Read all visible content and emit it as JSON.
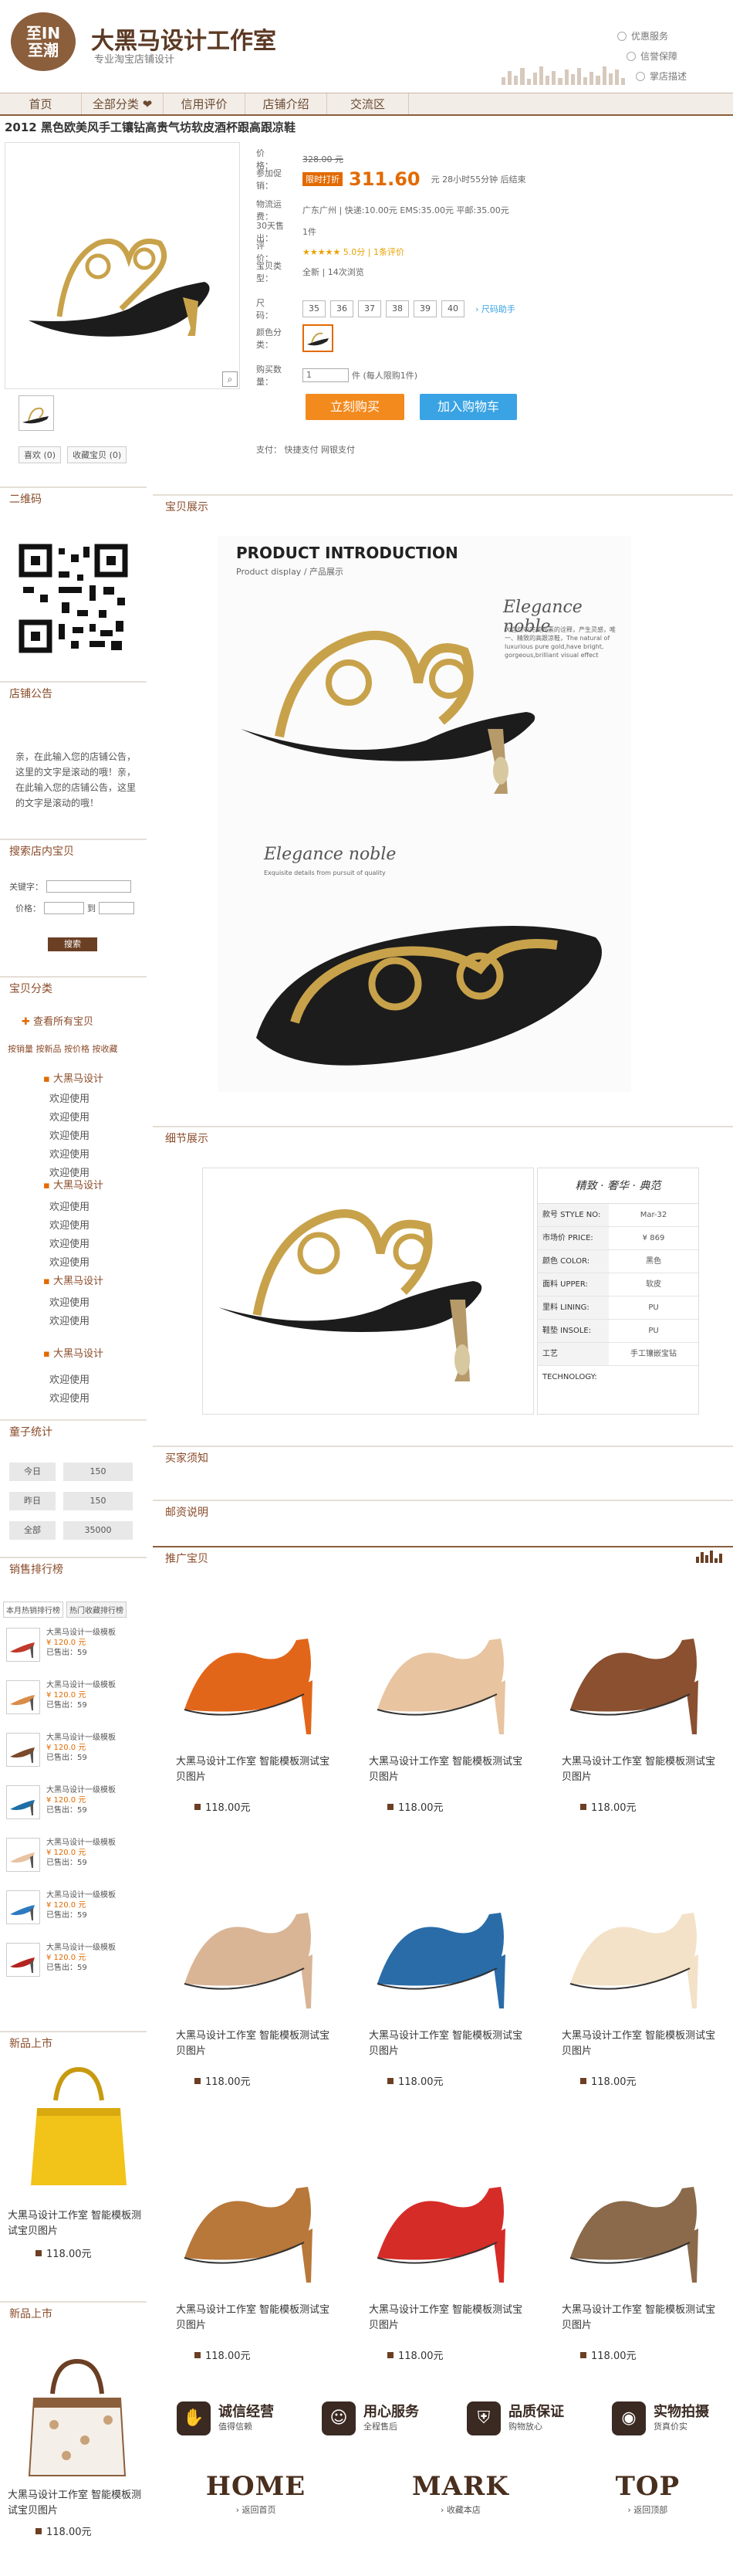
{
  "header": {
    "logo_lines": [
      "至IN",
      "至潮"
    ],
    "shop_name": "大黑马设计工作室",
    "shop_sub": "专业淘宝店铺设计",
    "links": [
      "优惠服务",
      "信誉保障",
      "掌店描述"
    ]
  },
  "nav": [
    "首页",
    "全部分类 ❤",
    "信用评价",
    "店铺介绍",
    "交流区"
  ],
  "product": {
    "title": "2012 黑色欧美风手工镶钻高贵气坊软皮酒杯跟高跟凉鞋",
    "price_label": "价　　格：",
    "price": "328.00 元",
    "promo_label": "参加促销：",
    "promo_tag": "限时打折",
    "promo_price": "311.60",
    "promo_tail": "元  28小时55分钟  后结束",
    "ship_label": "物流运费：",
    "ship_value": "广东广州 | 快递:10.00元 EMS:35.00元 平邮:35.00元",
    "sold_label": "30天售出：",
    "sold_value": "1件",
    "rate_label": "评　　价：",
    "rate_value": "★★★★★ 5.0分  |  1条评价",
    "type_label": "宝贝类型：",
    "type_value": "全新  |  14次浏览",
    "size_label": "尺　　码：",
    "sizes": [
      "35",
      "36",
      "37",
      "38",
      "39",
      "40"
    ],
    "size_help": "› 尺码助手",
    "color_label": "颜色分类：",
    "qty_label": "购买数量：",
    "qty_value": "1",
    "qty_tail": "件  (每人限购1件)",
    "buy_label": "立刻购买",
    "cart_label": "加入购物车",
    "pay_text": "支付：  快捷支付    网银支付",
    "share_like": "喜欢 (0)",
    "share_fav": "收藏宝贝 (0)"
  },
  "sidebar": {
    "qr_title": "二维码",
    "notice_title": "店铺公告",
    "notice_text": "亲，在此输入您的店铺公告，这里的文字是滚动的哦！亲，在此输入您的店铺公告，这里的文字是滚动的哦！",
    "search_title": "搜索店内宝贝",
    "kw_label": "关键字：",
    "price_label": "价格：",
    "price_to": "到",
    "search_btn": "搜索",
    "cat_title": "宝贝分类",
    "all_items": "查看所有宝贝",
    "sort_links": "按销量  按新品  按价格  按收藏",
    "groups": [
      {
        "name": "大黑马设计",
        "subs": [
          "欢迎使用",
          "欢迎使用",
          "欢迎使用",
          "欢迎使用",
          "欢迎使用"
        ]
      },
      {
        "name": "大黑马设计",
        "subs": [
          "欢迎使用",
          "欢迎使用",
          "欢迎使用",
          "欢迎使用"
        ]
      },
      {
        "name": "大黑马设计",
        "subs": [
          "欢迎使用",
          "欢迎使用"
        ]
      },
      {
        "name": "大黑马设计",
        "subs": [
          "欢迎使用",
          "欢迎使用"
        ]
      }
    ],
    "stat_title": "童子统计",
    "stats": [
      {
        "k": "今日",
        "v": "150"
      },
      {
        "k": "昨日",
        "v": "150"
      },
      {
        "k": "全部",
        "v": "35000"
      }
    ],
    "rank_title": "销售排行榜",
    "rank_tabs": [
      "本月热销排行榜",
      "热门收藏排行榜"
    ],
    "rank_item": {
      "name": "大黑马设计一级模板",
      "price": "¥ 120.0 元",
      "sold": "已售出：59"
    },
    "new_title": "新品上市",
    "new_name": "大黑马设计工作室 智能模板测试宝贝图片",
    "new_price": "118.00元",
    "new_title2": "新品上市"
  },
  "main": {
    "display_title": "宝贝展示",
    "intro_title": "PRODUCT INTRODUCTION",
    "intro_sub": "Product display /  产品展示",
    "elegance1": "Elegance noble",
    "elegance_text": "大自然中完美元素的诠释，产生灵感，唯一、精致的高跟凉鞋，The natural of luxurious pure gold,have bright, gorgeous,brilliant visual effect",
    "elegance2": "Elegance noble",
    "elegance_text2": "Exquisite details from pursuit of quality",
    "detail_title": "细节展示",
    "spec_head": "精致 · 奢华 · 典范",
    "spec": [
      {
        "k": "款号 STYLE NO:",
        "v": "Mar-32"
      },
      {
        "k": "市场价 PRICE:",
        "v": "¥ 869"
      },
      {
        "k": "颜色 COLOR:",
        "v": "黑色"
      },
      {
        "k": "面料 UPPER:",
        "v": "软皮"
      },
      {
        "k": "里料 LINING:",
        "v": "PU"
      },
      {
        "k": "鞋垫 INSOLE:",
        "v": "PU"
      },
      {
        "k": "工艺 TECHNOLOGY:",
        "v": "手工镶嵌宝钻"
      }
    ],
    "notice_title": "买家须知",
    "postage_title": "邮资说明",
    "promo_title": "推广宝贝",
    "card_name": "大黑马设计工作室 智能模板测试宝贝图片",
    "card_price": "118.00元"
  },
  "features": [
    {
      "icon": "handshake-icon",
      "title": "诚信经营",
      "sub": "值得信赖"
    },
    {
      "icon": "people-icon",
      "title": "用心服务",
      "sub": "全程售后"
    },
    {
      "icon": "shield-icon",
      "title": "品质保证",
      "sub": "购物放心"
    },
    {
      "icon": "camera-icon",
      "title": "实物拍摄",
      "sub": "货真价实"
    }
  ],
  "footer": [
    {
      "big": "HOME",
      "sm": "› 返回首页"
    },
    {
      "big": "MARK",
      "sm": "› 收藏本店"
    },
    {
      "big": "TOP",
      "sm": "› 返回顶部"
    }
  ],
  "colors": {
    "brand_brown": "#8b5e3c",
    "accent_orange": "#f38a1d",
    "cart_blue": "#39a3e4"
  }
}
